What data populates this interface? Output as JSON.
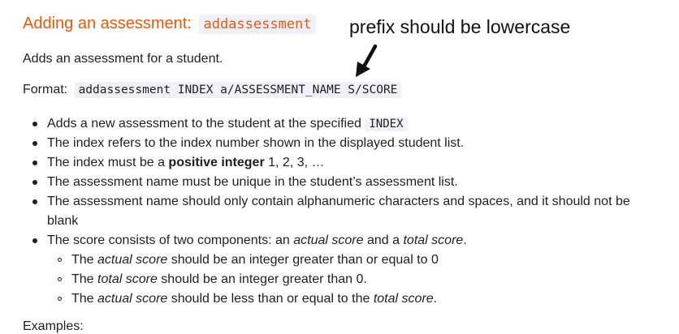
{
  "heading": {
    "text": "Adding an assessment:",
    "command": "addassessment"
  },
  "intro": "Adds an assessment for a student.",
  "format": {
    "label": "Format:",
    "syntax": "addassessment INDEX a/ASSESSMENT_NAME S/SCORE"
  },
  "bullets": {
    "b1_text": "Adds a new assessment to the student at the specified",
    "b1_code": "INDEX",
    "b2": "The index refers to the index number shown in the displayed student list.",
    "b3_pre": "The index must be a",
    "b3_bold": "positive integer",
    "b3_post": "1, 2, 3, …",
    "b4": "The assessment name must be unique in the student’s assessment list.",
    "b5": "The assessment name should only contain alphanumeric characters and spaces, and it should not be blank",
    "b6_pre": "The score consists of two components: an",
    "b6_em1": "actual score",
    "b6_mid": "and a",
    "b6_em2": "total score",
    "b6_post": "."
  },
  "sub_bullets": {
    "s1_pre": "The",
    "s1_em": "actual score",
    "s1_post": "should be an integer greater than or equal to 0",
    "s2_pre": "The",
    "s2_em": "total score",
    "s2_post": "should be an integer greater than 0.",
    "s3_pre": "The",
    "s3_em1": "actual score",
    "s3_mid": "should be less than or equal to the",
    "s3_em2": "total score",
    "s3_post": "."
  },
  "annotation": {
    "text": "prefix should be lowercase",
    "icon": "arrow-down-left-icon"
  },
  "cutoff_text": "Examples:",
  "colors": {
    "heading": "#e8590c",
    "code_bg": "#f1f0fb",
    "text": "#1f1f1f"
  }
}
